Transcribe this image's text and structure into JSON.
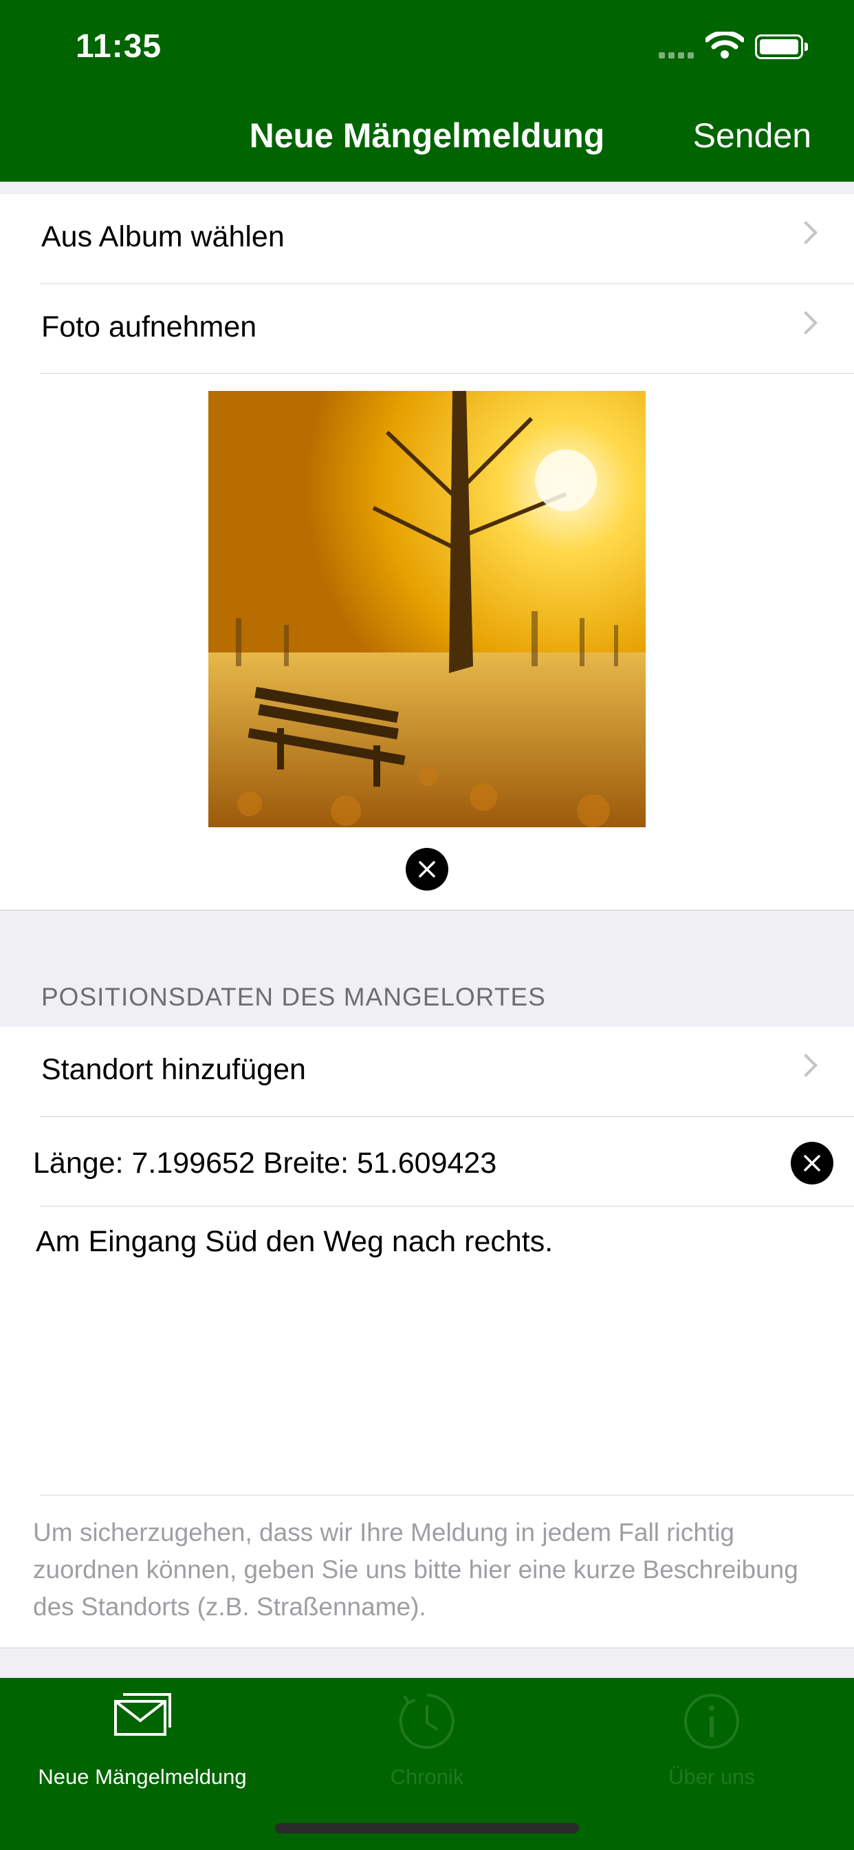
{
  "status_bar": {
    "time": "11:35"
  },
  "nav": {
    "title": "Neue Mängelmeldung",
    "send_label": "Senden"
  },
  "photo_section": {
    "album_label": "Aus Album wählen",
    "camera_label": "Foto aufnehmen"
  },
  "location_section": {
    "header": "POSITIONSDATEN DES MANGELORTES",
    "add_location_label": "Standort hinzufügen",
    "coordinates": "Länge: 7.199652 Breite: 51.609423",
    "description": "Am Eingang Süd den Weg nach rechts.",
    "hint": "Um sicherzugehen, dass wir Ihre Meldung in jedem Fall richtig zuordnen können, geben Sie uns bitte hier eine kurze Beschreibung des Standorts (z.B. Straßenname)."
  },
  "tabs": [
    {
      "label": "Neue Mängelmeldung",
      "icon": "envelope-icon",
      "active": true
    },
    {
      "label": "Chronik",
      "icon": "clock-icon",
      "active": false
    },
    {
      "label": "Über uns",
      "icon": "info-icon",
      "active": false
    }
  ],
  "colors": {
    "brand_green": "#006400",
    "background": "#efeff4"
  }
}
